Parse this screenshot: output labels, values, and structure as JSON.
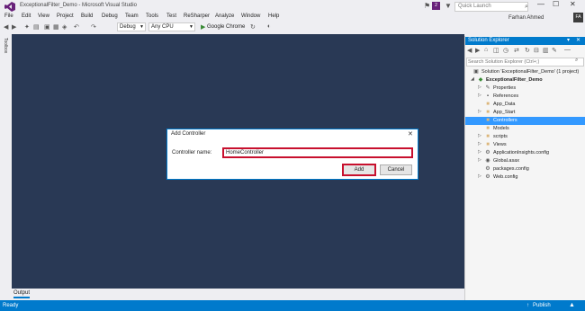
{
  "window": {
    "title": "ExceptionalFilter_Demo - Microsoft Visual Studio",
    "notification_count": "2",
    "quick_launch_placeholder": "Quick Launch"
  },
  "menu": [
    "File",
    "Edit",
    "View",
    "Project",
    "Build",
    "Debug",
    "Team",
    "Tools",
    "Test",
    "ReSharper",
    "Analyze",
    "Window",
    "Help"
  ],
  "user": {
    "name": "Farhan Ahmed",
    "initials": "FA"
  },
  "toolbar": {
    "config": "Debug",
    "platform": "Any CPU",
    "run_target": "Google Chrome"
  },
  "toolbox_label": "Toolbox",
  "output_tab": "Output",
  "status": {
    "text": "Ready",
    "publish": "Publish"
  },
  "solution_explorer": {
    "title": "Solution Explorer",
    "search_placeholder": "Search Solution Explorer (Ctrl+;)",
    "items": [
      {
        "label": "Solution 'ExceptionalFilter_Demo' (1 project)",
        "icon": "solution-icon"
      },
      {
        "label": "ExceptionalFilter_Demo",
        "icon": "project-icon"
      },
      {
        "label": "Properties",
        "icon": "wrench-icon"
      },
      {
        "label": "References",
        "icon": "references-icon"
      },
      {
        "label": "App_Data",
        "icon": "folder-icon"
      },
      {
        "label": "App_Start",
        "icon": "folder-icon"
      },
      {
        "label": "Controllers",
        "icon": "folder-icon"
      },
      {
        "label": "Models",
        "icon": "folder-icon"
      },
      {
        "label": "scripts",
        "icon": "folder-icon"
      },
      {
        "label": "Views",
        "icon": "folder-icon"
      },
      {
        "label": "ApplicationInsights.config",
        "icon": "config-file-icon"
      },
      {
        "label": "Global.asax",
        "icon": "asax-file-icon"
      },
      {
        "label": "packages.config",
        "icon": "config-file-icon"
      },
      {
        "label": "Web.config",
        "icon": "config-file-icon"
      }
    ]
  },
  "dialog": {
    "title": "Add Controller",
    "label": "Controller name:",
    "value": "HomeController",
    "add": "Add",
    "cancel": "Cancel"
  },
  "colors": {
    "accent": "#007acc",
    "editor_bg": "#293955",
    "selection": "#3399ff",
    "highlight_box": "#c8102e"
  }
}
